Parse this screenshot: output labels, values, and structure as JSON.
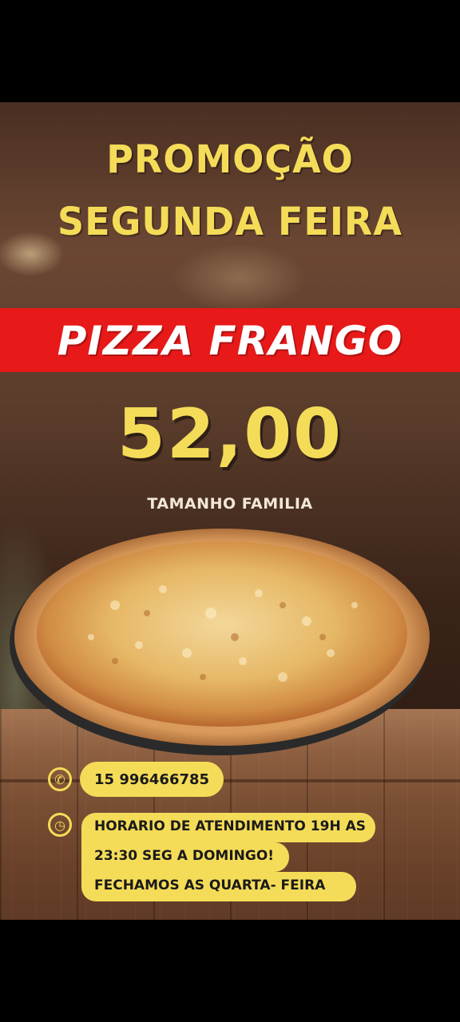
{
  "flyer": {
    "headline_line1": "PROMOÇÃO",
    "headline_line2": "SEGUNDA FEIRA",
    "product": "PIZZA FRANGO",
    "price": "52,00",
    "size": "TAMANHO FAMILIA"
  },
  "contact": {
    "phone_icon": "phone-icon",
    "phone": "15 996466785",
    "clock_icon": "clock-icon",
    "hours_line1": "HORARIO DE ATENDIMENTO 19H AS",
    "hours_line2": "23:30 SEG A DOMINGO!",
    "hours_line3": "FECHAMOS AS QUARTA- FEIRA"
  },
  "colors": {
    "accent_yellow": "#f5dc58",
    "band_red": "#e81919",
    "background": "#000000"
  }
}
